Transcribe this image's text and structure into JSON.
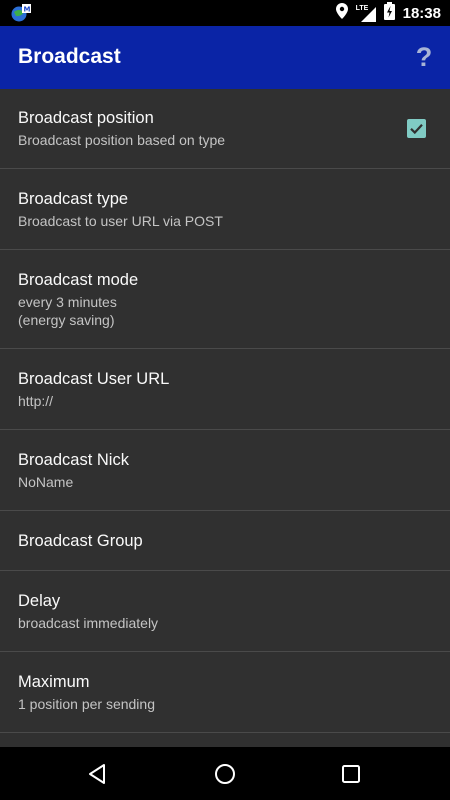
{
  "status_bar": {
    "time": "18:38",
    "network_label": "LTE",
    "icons": [
      "app-notification-icon",
      "location-icon",
      "signal-icon",
      "battery-charging-icon"
    ]
  },
  "app_bar": {
    "title": "Broadcast",
    "help_label": "?"
  },
  "preferences": [
    {
      "title": "Broadcast position",
      "summary": [
        "Broadcast position based on type"
      ],
      "checked": true
    },
    {
      "title": "Broadcast type",
      "summary": [
        "Broadcast to user URL via POST"
      ]
    },
    {
      "title": "Broadcast mode",
      "summary": [
        "every 3 minutes",
        "(energy saving)"
      ]
    },
    {
      "title": "Broadcast User URL",
      "summary": [
        "http://"
      ]
    },
    {
      "title": "Broadcast Nick",
      "summary": [
        "NoName"
      ]
    },
    {
      "title": "Broadcast Group",
      "summary": []
    },
    {
      "title": "Delay",
      "summary": [
        "broadcast immediately"
      ]
    },
    {
      "title": "Maximum",
      "summary": [
        "1 position per sending"
      ]
    }
  ],
  "nav_bar": {
    "icons": [
      "back-icon",
      "home-icon",
      "recents-icon"
    ]
  },
  "colors": {
    "app_bar": "#0a24a6",
    "background": "#303030",
    "checkbox_accent": "#80cbc4"
  }
}
